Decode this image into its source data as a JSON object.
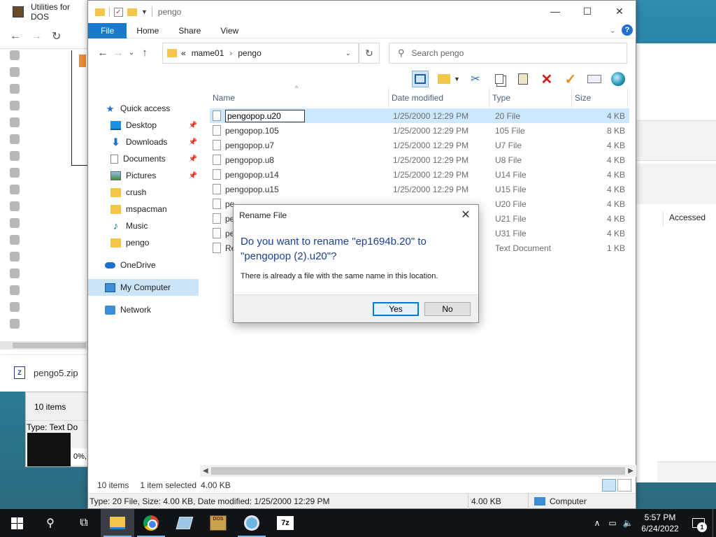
{
  "background_window": {
    "title": "Utilities for DOS",
    "download_name": "pengo5.zip"
  },
  "background_window2": {
    "items": "10 items",
    "type_prefix": "Type: Text Do",
    "percent": "0%,"
  },
  "right_window": {
    "accessed_header": "Accessed"
  },
  "explorer": {
    "title": "pengo",
    "ribbon_tabs": [
      "File",
      "Home",
      "Share",
      "View"
    ],
    "address": {
      "prefix": "«",
      "crumbs": [
        "mame01",
        "pengo"
      ]
    },
    "search_placeholder": "Search pengo",
    "nav": {
      "quick_access": "Quick access",
      "items": [
        "Desktop",
        "Downloads",
        "Documents",
        "Pictures",
        "crush",
        "mspacman",
        "Music",
        "pengo"
      ],
      "onedrive": "OneDrive",
      "my_computer": "My Computer",
      "network": "Network"
    },
    "columns": [
      "Name",
      "Date modified",
      "Type",
      "Size"
    ],
    "files": [
      {
        "name": "pengopop.u20",
        "date": "1/25/2000 12:29 PM",
        "type": "20 File",
        "size": "4 KB"
      },
      {
        "name": "pengopop.105",
        "date": "1/25/2000 12:29 PM",
        "type": "105 File",
        "size": "8 KB"
      },
      {
        "name": "pengopop.u7",
        "date": "1/25/2000 12:29 PM",
        "type": "U7 File",
        "size": "4 KB"
      },
      {
        "name": "pengopop.u8",
        "date": "1/25/2000 12:29 PM",
        "type": "U8 File",
        "size": "4 KB"
      },
      {
        "name": "pengopop.u14",
        "date": "1/25/2000 12:29 PM",
        "type": "U14 File",
        "size": "4 KB"
      },
      {
        "name": "pengopop.u15",
        "date": "1/25/2000 12:29 PM",
        "type": "U15 File",
        "size": "4 KB"
      },
      {
        "name": "pe",
        "date": "",
        "type": "U20 File",
        "size": "4 KB"
      },
      {
        "name": "pe",
        "date": "",
        "type": "U21 File",
        "size": "4 KB"
      },
      {
        "name": "pe",
        "date": "",
        "type": "U31 File",
        "size": "4 KB"
      },
      {
        "name": "Re",
        "date": "",
        "type": "Text Document",
        "size": "1 KB"
      }
    ],
    "status": {
      "items": "10 items",
      "selected": "1 item selected",
      "selected_size": "4.00 KB"
    },
    "details_bar": {
      "info": "Type: 20 File, Size: 4.00 KB, Date modified: 1/25/2000 12:29 PM",
      "size": "4.00 KB",
      "location": "Computer"
    }
  },
  "dialog": {
    "title": "Rename File",
    "question": "Do you want to rename \"ep1694b.20\" to \"pengopop (2).u20\"?",
    "message": "There is already a file with the same name in this location.",
    "yes": "Yes",
    "no": "No"
  },
  "taskbar": {
    "time": "5:57 PM",
    "date": "6/24/2022",
    "notification_count": "1",
    "dos_label": "DOS"
  }
}
